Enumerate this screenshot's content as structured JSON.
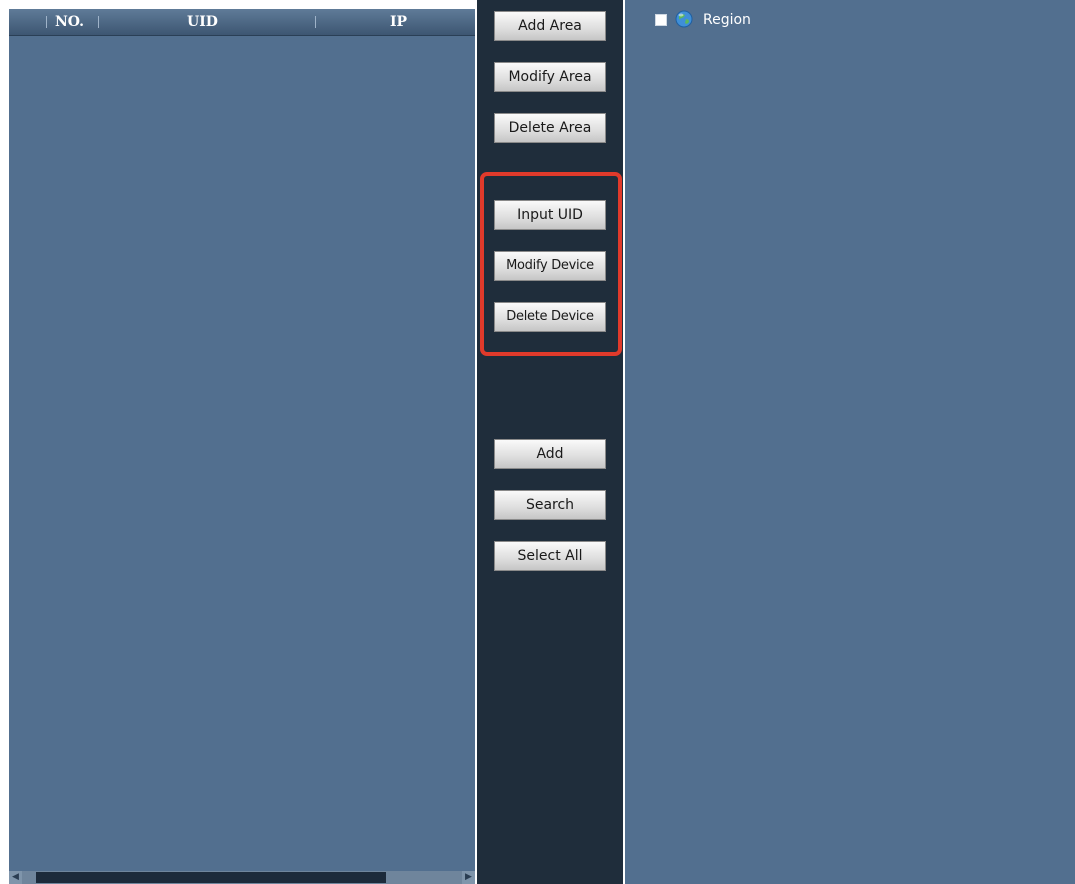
{
  "device_list": {
    "columns": [
      "NO.",
      "UID",
      "IP"
    ],
    "rows": []
  },
  "actions": {
    "area": [
      "Add Area",
      "Modify Area",
      "Delete Area"
    ],
    "device": [
      "Input UID",
      "Modify Device",
      "Delete Device"
    ],
    "general": [
      "Add",
      "Search",
      "Select All"
    ]
  },
  "region_tree": {
    "root_label": "Region",
    "root_icon": "globe-icon",
    "root_checked": false
  },
  "colors": {
    "panel_bg": "#526f8f",
    "action_bg": "#1f2d3b",
    "highlight": "#e03a2b"
  }
}
